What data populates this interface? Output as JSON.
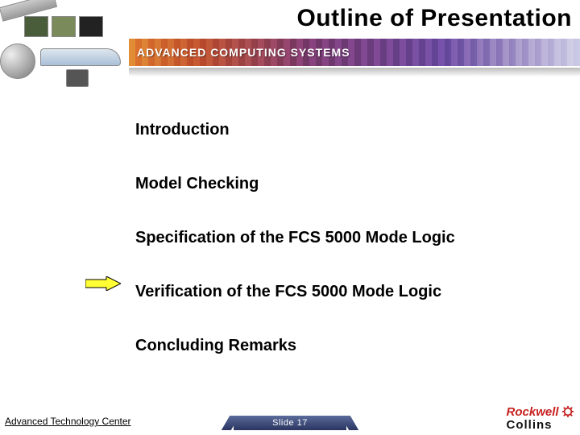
{
  "header": {
    "title": "Outline of Presentation",
    "banner_text": "ADVANCED COMPUTING SYSTEMS"
  },
  "outline": {
    "items": [
      "Introduction",
      "Model Checking",
      "Specification of the FCS 5000 Mode Logic",
      "Verification of the FCS 5000 Mode Logic",
      "Concluding Remarks"
    ],
    "current_index": 3
  },
  "footer": {
    "left_text": "Advanced Technology Center",
    "slide_label": "Slide 17",
    "logo_top": "Rockwell",
    "logo_bottom": "Collins"
  }
}
